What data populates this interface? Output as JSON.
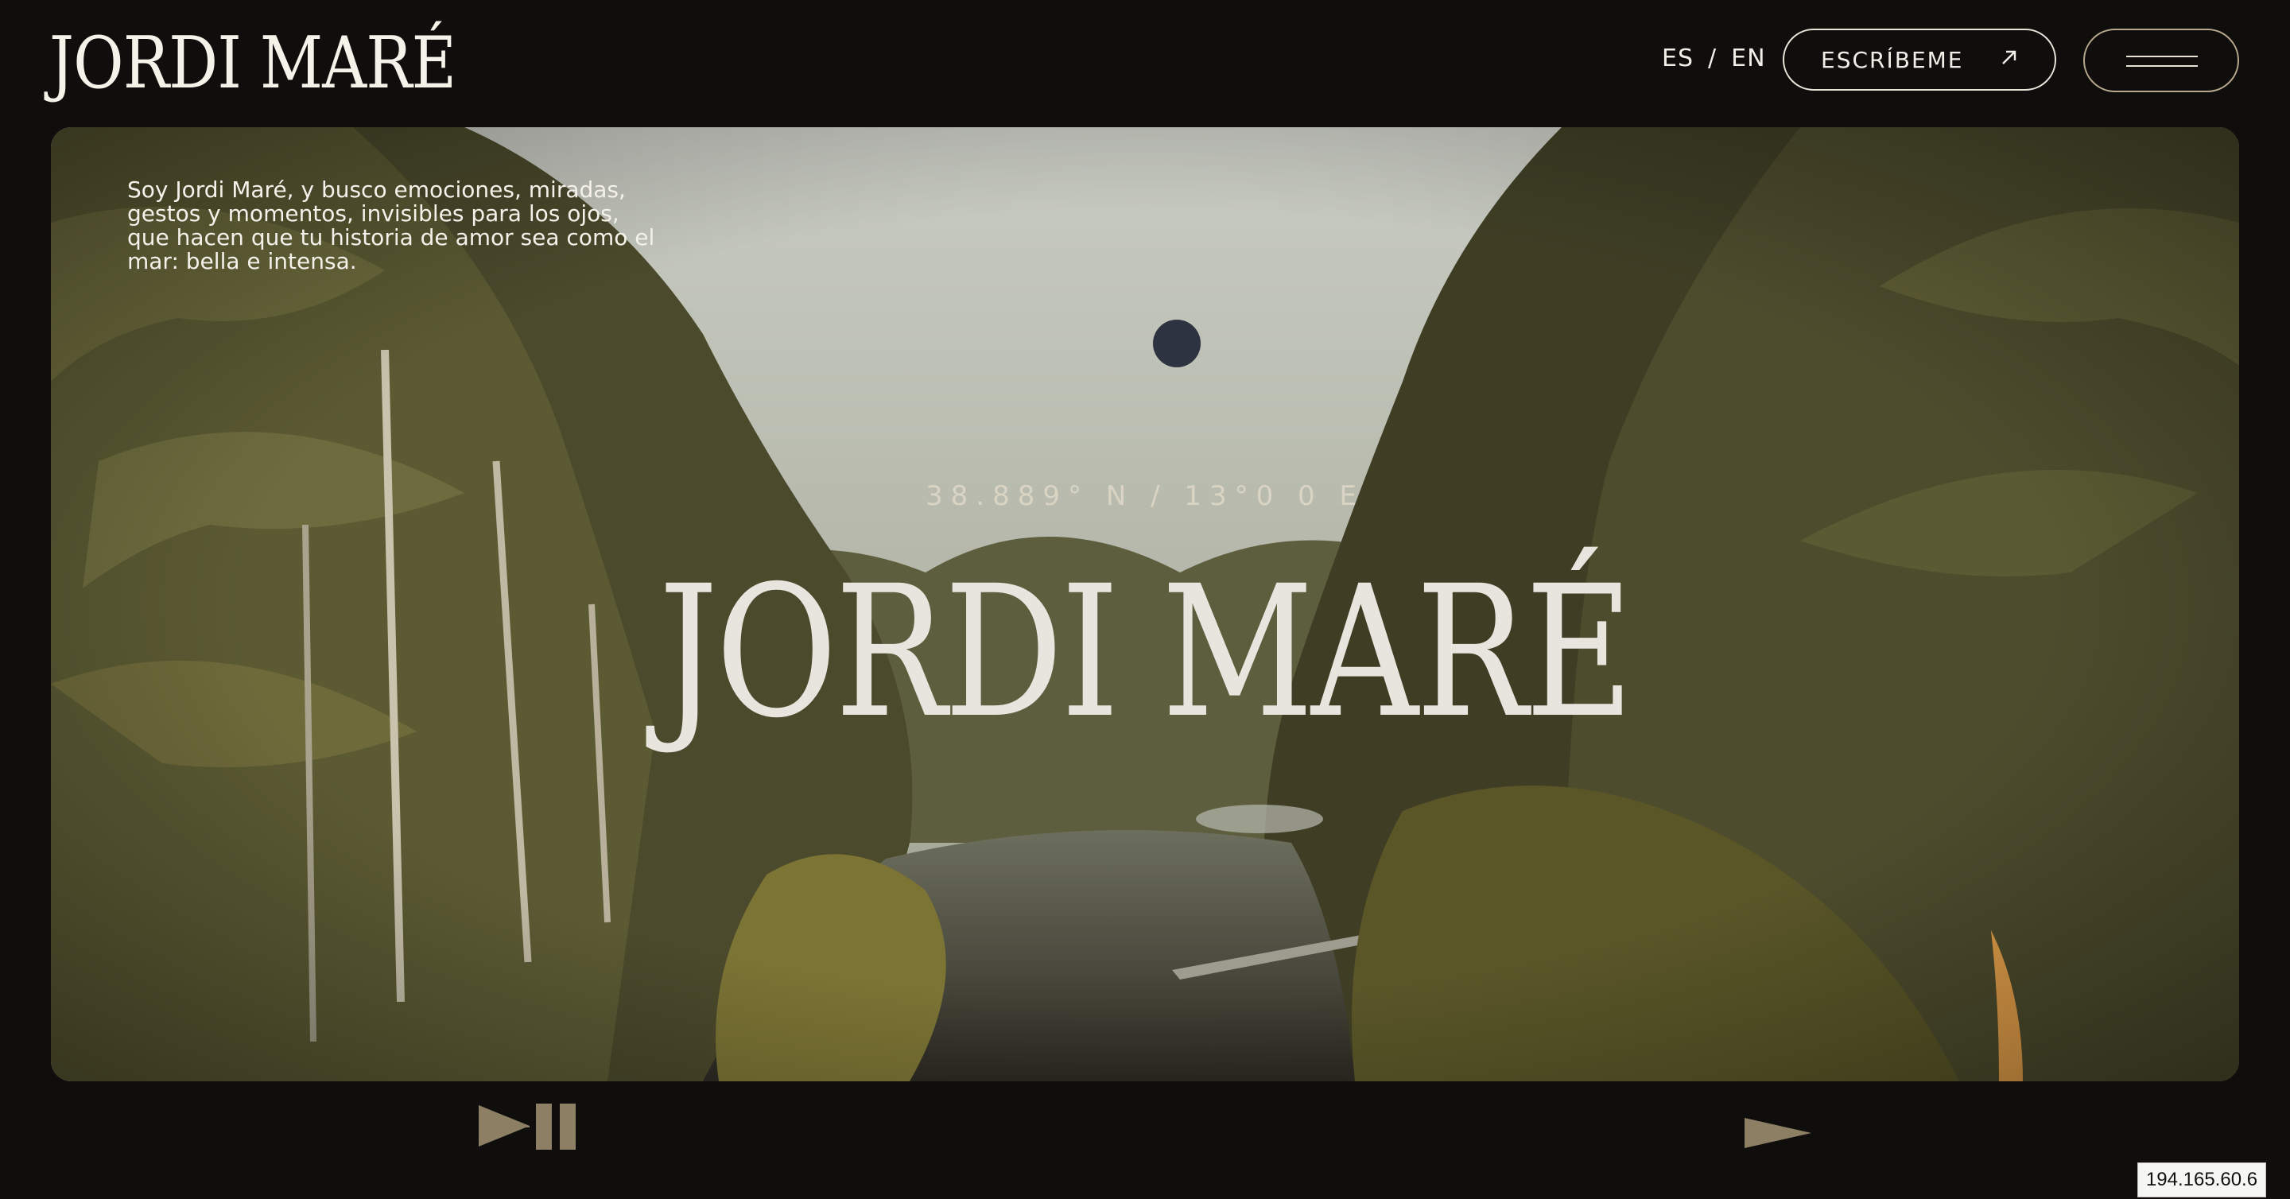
{
  "header": {
    "logo_text": "JORDI MARÉ",
    "lang_es": "ES",
    "lang_sep": "/",
    "lang_en": "EN",
    "contact_label": "ESCRÍBEME",
    "contact_icon": "arrow-up-right-icon",
    "menu_icon": "hamburger-icon"
  },
  "hero": {
    "intro_text": "Soy Jordi Maré, y busco emociones, miradas, gestos y momentos, invisibles para los ojos, que hacen que tu historia de amor sea como el mar: bella e intensa.",
    "coordinates": "38.889° N / 13°0 0 E",
    "title": "JORDI MARÉ"
  },
  "controls": {
    "play_pause_icon": "play-pause-icon",
    "next_icon": "next-arrow-icon"
  },
  "overlay": {
    "ip_address": "194.165.60.6"
  },
  "colors": {
    "background": "#0f0e0d",
    "text": "#f2efe8",
    "accent": "#8d7f64",
    "menu_border": "#b8a98c"
  }
}
